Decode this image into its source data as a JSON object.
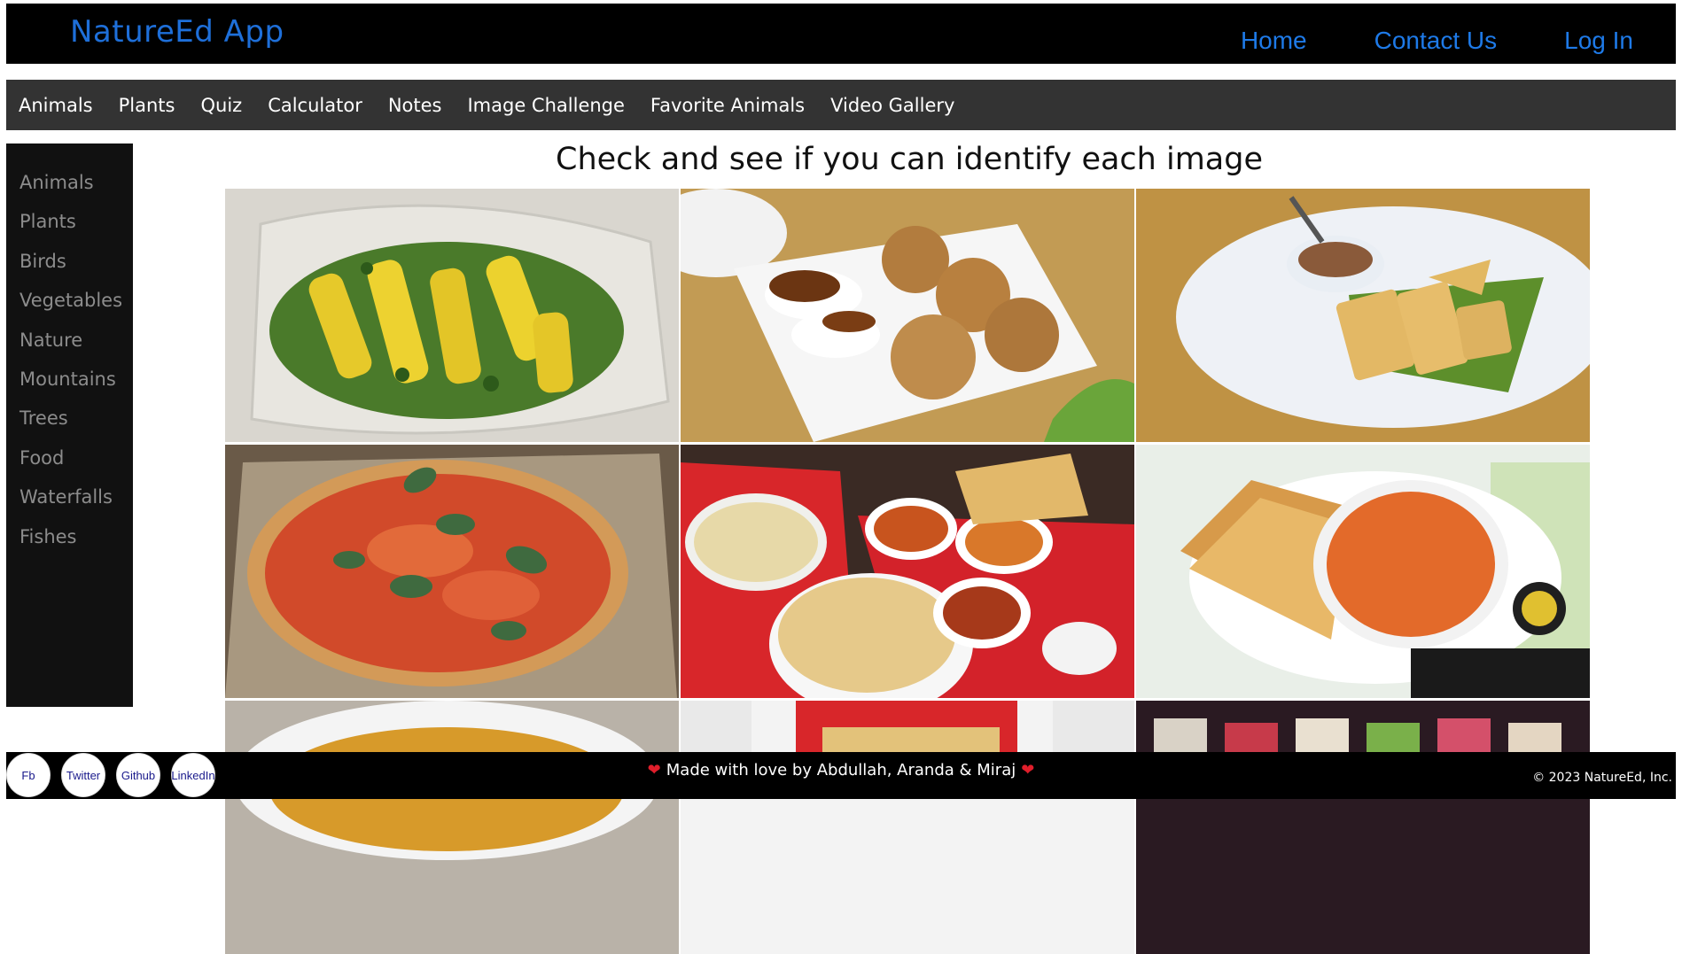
{
  "header": {
    "brand": "NatureEd App",
    "links": [
      "Home",
      "Contact Us",
      "Log In"
    ]
  },
  "navbar": {
    "items": [
      "Animals",
      "Plants",
      "Quiz",
      "Calculator",
      "Notes",
      "Image Challenge",
      "Favorite Animals",
      "Video Gallery"
    ]
  },
  "sidebar": {
    "items": [
      "Animals",
      "Plants",
      "Birds",
      "Vegetables",
      "Nature",
      "Mountains",
      "Trees",
      "Food",
      "Waterfalls",
      "Fishes"
    ]
  },
  "main": {
    "title": "Check and see if you can identify each image"
  },
  "footer": {
    "heart_glyph": "❤",
    "message": "Made with love by Abdullah, Aranda & Miraj",
    "copyright": "© 2023 NatureEd, Inc.",
    "social": [
      "Fb",
      "Twitter",
      "Github",
      "LinkedIn"
    ]
  },
  "colors": {
    "brand": "#1e6fd9",
    "navbar_bg": "#333333",
    "sidebar_bg": "#111111",
    "sidebar_text": "#8c8c8c",
    "heart": "#e01e2b"
  }
}
